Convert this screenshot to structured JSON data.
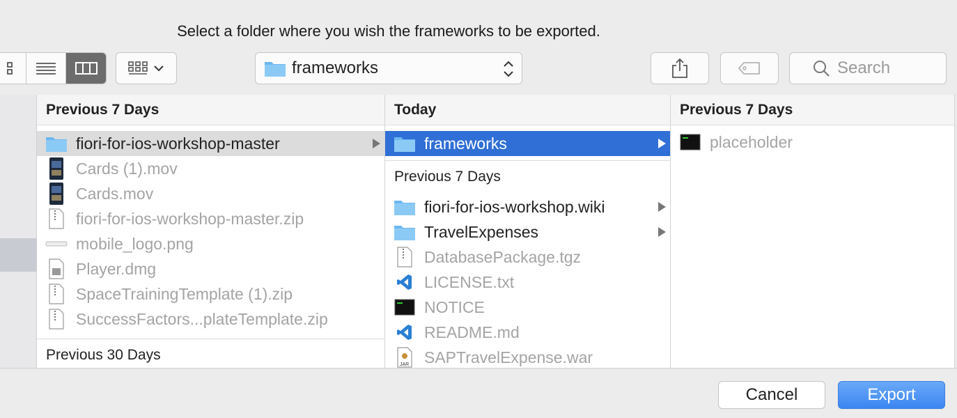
{
  "dialog": {
    "prompt": "Select a folder where you wish the frameworks to be exported."
  },
  "toolbar": {
    "view_modes": [
      "icon-view",
      "list-view",
      "column-view"
    ],
    "active_view": "column-view",
    "group_button_icon": "grid-icon",
    "path_popup": "frameworks",
    "share_icon": "share-icon",
    "tag_icon": "tag-icon",
    "search_placeholder": "Search"
  },
  "column1": {
    "header": "Previous 7 Days",
    "items": [
      {
        "name": "fiori-for-ios-workshop-master",
        "icon": "folder-icon",
        "enabled": true
      },
      {
        "name": "Cards (1).mov",
        "icon": "movie-file-icon",
        "enabled": false
      },
      {
        "name": "Cards.mov",
        "icon": "movie-file-icon",
        "enabled": false
      },
      {
        "name": "fiori-for-ios-workshop-master.zip",
        "icon": "zip-file-icon",
        "enabled": false
      },
      {
        "name": "mobile_logo.png",
        "icon": "image-file-icon",
        "enabled": false
      },
      {
        "name": "Player.dmg",
        "icon": "disk-image-icon",
        "enabled": false
      },
      {
        "name": "SpaceTrainingTemplate (1).zip",
        "icon": "zip-file-icon",
        "enabled": false
      },
      {
        "name": "SuccessFactors...plateTemplate.zip",
        "icon": "zip-file-icon",
        "enabled": false
      }
    ],
    "section2": "Previous 30 Days"
  },
  "column2": {
    "header": "Today",
    "selected": "frameworks",
    "section2": "Previous 7 Days",
    "items": [
      {
        "name": "fiori-for-ios-workshop.wiki",
        "icon": "folder-icon",
        "enabled": true
      },
      {
        "name": "TravelExpenses",
        "icon": "folder-icon",
        "enabled": true
      },
      {
        "name": "DatabasePackage.tgz",
        "icon": "zip-file-icon",
        "enabled": false
      },
      {
        "name": "LICENSE.txt",
        "icon": "vscode-file-icon",
        "enabled": false
      },
      {
        "name": "NOTICE",
        "icon": "terminal-file-icon",
        "enabled": false
      },
      {
        "name": "README.md",
        "icon": "vscode-file-icon",
        "enabled": false
      },
      {
        "name": "SAPTravelExpense.war",
        "icon": "jar-file-icon",
        "enabled": false
      }
    ]
  },
  "column3": {
    "header": "Previous 7 Days",
    "items": [
      {
        "name": "placeholder",
        "icon": "terminal-file-icon",
        "enabled": false
      }
    ]
  },
  "buttons": {
    "cancel": "Cancel",
    "export": "Export"
  },
  "colors": {
    "selection": "#2f6fd6",
    "export_button": "#3c86f2",
    "folder": "#6db7f0"
  }
}
